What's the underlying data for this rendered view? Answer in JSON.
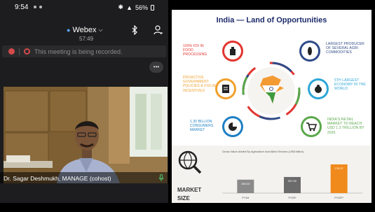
{
  "status_bar": {
    "time": "9:54",
    "right_text": "56%"
  },
  "webex": {
    "title": "Webex",
    "timer": "57:49",
    "recording_notice": "This meeting is being recorded.",
    "more_label": "•••"
  },
  "participant": {
    "name": "Dr. Sagar Deshmukh, MANAGE (cohost)"
  },
  "slide": {
    "title": "India — Land of Opportunities",
    "features": [
      {
        "text": "100% FDI in food processing",
        "color": "#e2342f"
      },
      {
        "text": "Proactive government policies & fiscal incentives",
        "color": "#f0a02b"
      },
      {
        "text": "1.30 billion consumers market",
        "color": "#1d7fc3"
      },
      {
        "text": "Largest producer of several agri commodities",
        "color": "#2e4a88"
      },
      {
        "text": "5th largest economy in the world",
        "color": "#2da6d8"
      },
      {
        "text": "India's retail market to reach USD 1.3 trillion by 2025",
        "color": "#5aa84b"
      }
    ],
    "market_size": {
      "label": "MARKET SIZE",
      "chart_title": "Gross Value Added By Agriculture And Allied Sectors (US$ billion)"
    }
  },
  "chart_data": {
    "type": "bar",
    "title": "Gross Value Added By Agriculture And Allied Sectors (US$ billion)",
    "categories": [
      "FY16",
      "FY20*",
      "FY22**"
    ],
    "values": [
      265.0,
      267.0,
      276.37
    ],
    "value_labels": [
      "265.00",
      "267.00",
      "276.37"
    ],
    "colors": [
      "#8a8a8a",
      "#6b6b6b",
      "#f08a1c"
    ],
    "xlabel": "",
    "ylabel": "",
    "ylim": [
      255,
      280
    ]
  }
}
